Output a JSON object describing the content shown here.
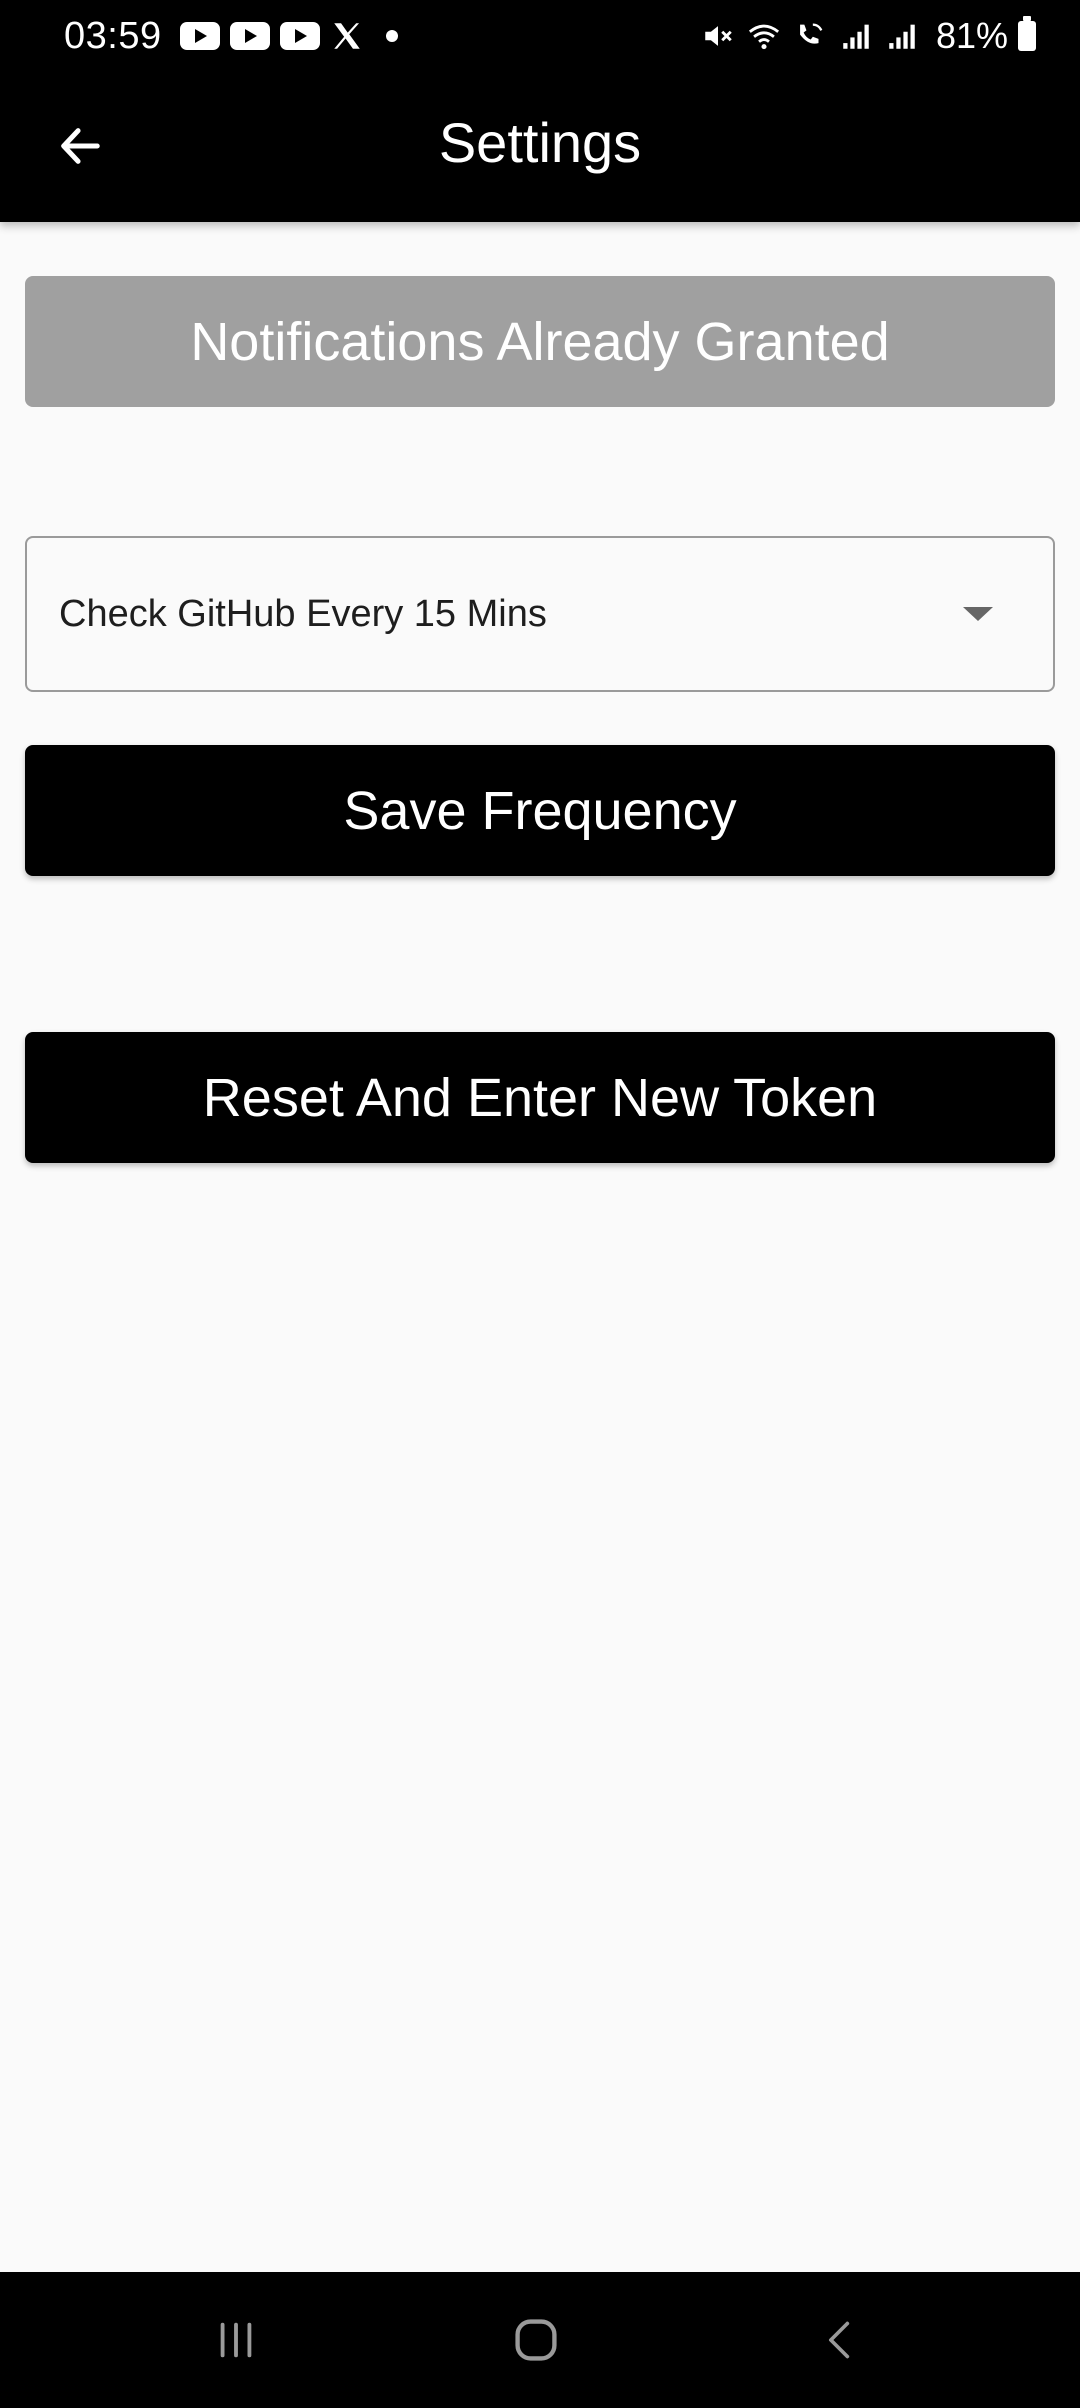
{
  "status_bar": {
    "time": "03:59",
    "notification_icons": [
      "youtube-icon",
      "youtube-icon",
      "youtube-icon",
      "x-icon",
      "dot-icon"
    ],
    "system_icons": [
      "mute-icon",
      "wifi-icon",
      "wifi-calling-icon",
      "signal-icon",
      "signal-icon",
      "battery-icon"
    ],
    "battery_percent": "81%"
  },
  "app_bar": {
    "title": "Settings",
    "back_icon": "arrow-left-icon"
  },
  "content": {
    "notifications_button_label": "Notifications Already Granted",
    "frequency_dropdown": {
      "selected": "Check GitHub Every 15 Mins",
      "icon": "caret-down-icon"
    },
    "save_button_label": "Save Frequency",
    "reset_button_label": "Reset And Enter New Token"
  },
  "nav_bar": {
    "buttons": [
      "recent-apps-icon",
      "home-icon",
      "back-icon"
    ]
  },
  "colors": {
    "bar_background": "#000000",
    "page_background": "#fafafa",
    "disabled_button": "#a0a0a0",
    "primary_button": "#000000",
    "button_text": "#ffffff"
  }
}
